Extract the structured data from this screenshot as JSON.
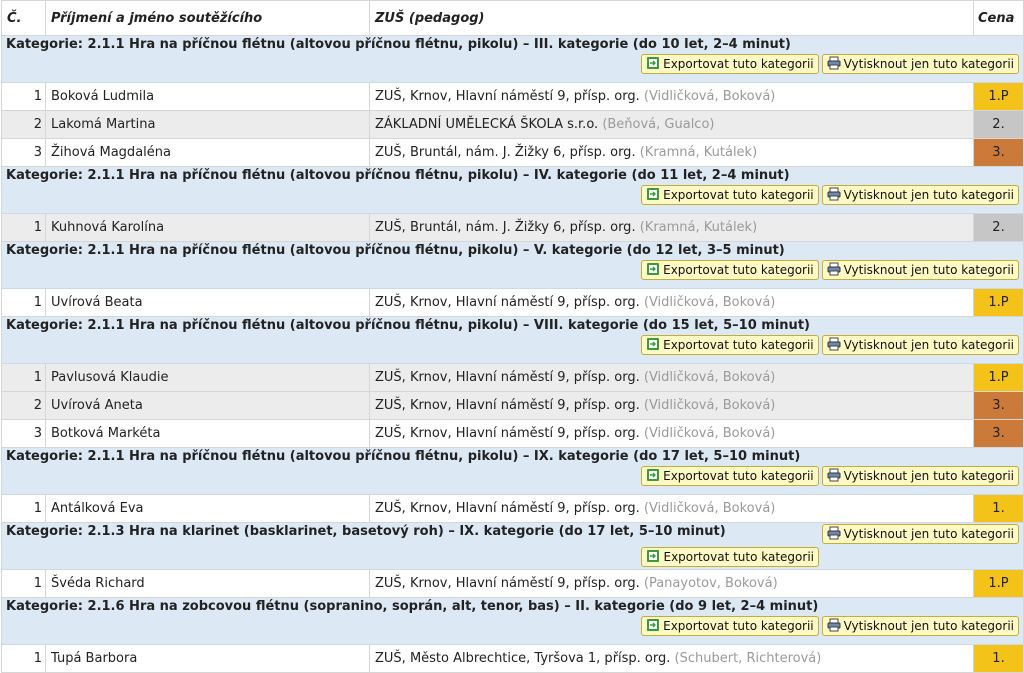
{
  "header": {
    "num": "Č.",
    "name": "Příjmení a jméno soutěžícího",
    "school": "ZUŠ (pedagog)",
    "prize": "Cena"
  },
  "buttons": {
    "export": "Exportovat tuto kategorii",
    "print": "Vytisknout jen tuto kategorii"
  },
  "colors": {
    "first": "#f4c319",
    "second": "#c6c6c6",
    "third": "#cc7a3a",
    "category_bg": "#dde8f5",
    "button_bg": "#fff9c4"
  },
  "categories": [
    {
      "title": "Kategorie: 2.1.1 Hra na příčnou flétnu (altovou příčnou flétnu, pikolu) – III. kategorie (do 10 let, 2–4 minut)",
      "entries": [
        {
          "n": "1",
          "name": "Boková Ludmila",
          "school": "ZUŠ, Krnov, Hlavní náměstí 9, přísp. org.",
          "teachers": "(Vidličková, Boková)",
          "prize": "1.P"
        },
        {
          "n": "2",
          "name": "Lakomá Martina",
          "school": "ZÁKLADNÍ UMĚLECKÁ ŠKOLA s.r.o.",
          "teachers": "(Beňová, Gualco)",
          "prize": "2."
        },
        {
          "n": "3",
          "name": "Žihová Magdaléna",
          "school": "ZUŠ, Bruntál, nám. J. Žižky 6, přísp. org.",
          "teachers": "(Kramná, Kutálek)",
          "prize": "3."
        }
      ]
    },
    {
      "title": "Kategorie: 2.1.1 Hra na příčnou flétnu (altovou příčnou flétnu, pikolu) – IV. kategorie (do 11 let, 2–4 minut)",
      "entries": [
        {
          "n": "1",
          "name": "Kuhnová Karolína",
          "school": "ZUŠ, Bruntál, nám. J. Žižky 6, přísp. org.",
          "teachers": "(Kramná, Kutálek)",
          "prize": "2."
        }
      ]
    },
    {
      "title": "Kategorie: 2.1.1 Hra na příčnou flétnu (altovou příčnou flétnu, pikolu) – V. kategorie (do 12 let, 3–5 minut)",
      "entries": [
        {
          "n": "1",
          "name": "Uvírová Beata",
          "school": "ZUŠ, Krnov, Hlavní náměstí 9, přísp. org.",
          "teachers": "(Vidličková, Boková)",
          "prize": "1.P"
        }
      ]
    },
    {
      "title": "Kategorie: 2.1.1 Hra na příčnou flétnu (altovou příčnou flétnu, pikolu) – VIII. kategorie (do 15 let, 5–10 minut)",
      "entries": [
        {
          "n": "1",
          "name": "Pavlusová Klaudie",
          "school": "ZUŠ, Krnov, Hlavní náměstí 9, přísp. org.",
          "teachers": "(Vidličková, Boková)",
          "prize": "1.P"
        },
        {
          "n": "2",
          "name": "Uvírová Aneta",
          "school": "ZUŠ, Krnov, Hlavní náměstí 9, přísp. org.",
          "teachers": "(Vidličková, Boková)",
          "prize": "3."
        },
        {
          "n": "3",
          "name": "Botková Markéta",
          "school": "ZUŠ, Krnov, Hlavní náměstí 9, přísp. org.",
          "teachers": "(Vidličková, Boková)",
          "prize": "3."
        }
      ]
    },
    {
      "title": "Kategorie: 2.1.1 Hra na příčnou flétnu (altovou příčnou flétnu, pikolu) – IX. kategorie (do 17 let, 5–10 minut)",
      "entries": [
        {
          "n": "1",
          "name": "Antálková Eva",
          "school": "ZUŠ, Krnov, Hlavní náměstí 9, přísp. org.",
          "teachers": "(Vidličková, Boková)",
          "prize": "1."
        }
      ]
    },
    {
      "title": "Kategorie: 2.1.3 Hra na klarinet (basklarinet, basetový roh) – IX. kategorie (do 17 let, 5–10 minut)",
      "entries": [
        {
          "n": "1",
          "name": "Švéda Richard",
          "school": "ZUŠ, Krnov, Hlavní náměstí 9, přísp. org.",
          "teachers": "(Panayotov, Boková)",
          "prize": "1.P"
        }
      ]
    },
    {
      "title": "Kategorie: 2.1.6 Hra na zobcovou flétnu (sopranino, soprán, alt, tenor, bas) – II. kategorie (do 9 let, 2–4 minut)",
      "entries": [
        {
          "n": "1",
          "name": "Tupá Barbora",
          "school": "ZUŠ, Město Albrechtice, Tyršova 1, přísp. org.",
          "teachers": "(Schubert, Richterová)",
          "prize": "1."
        }
      ]
    }
  ]
}
